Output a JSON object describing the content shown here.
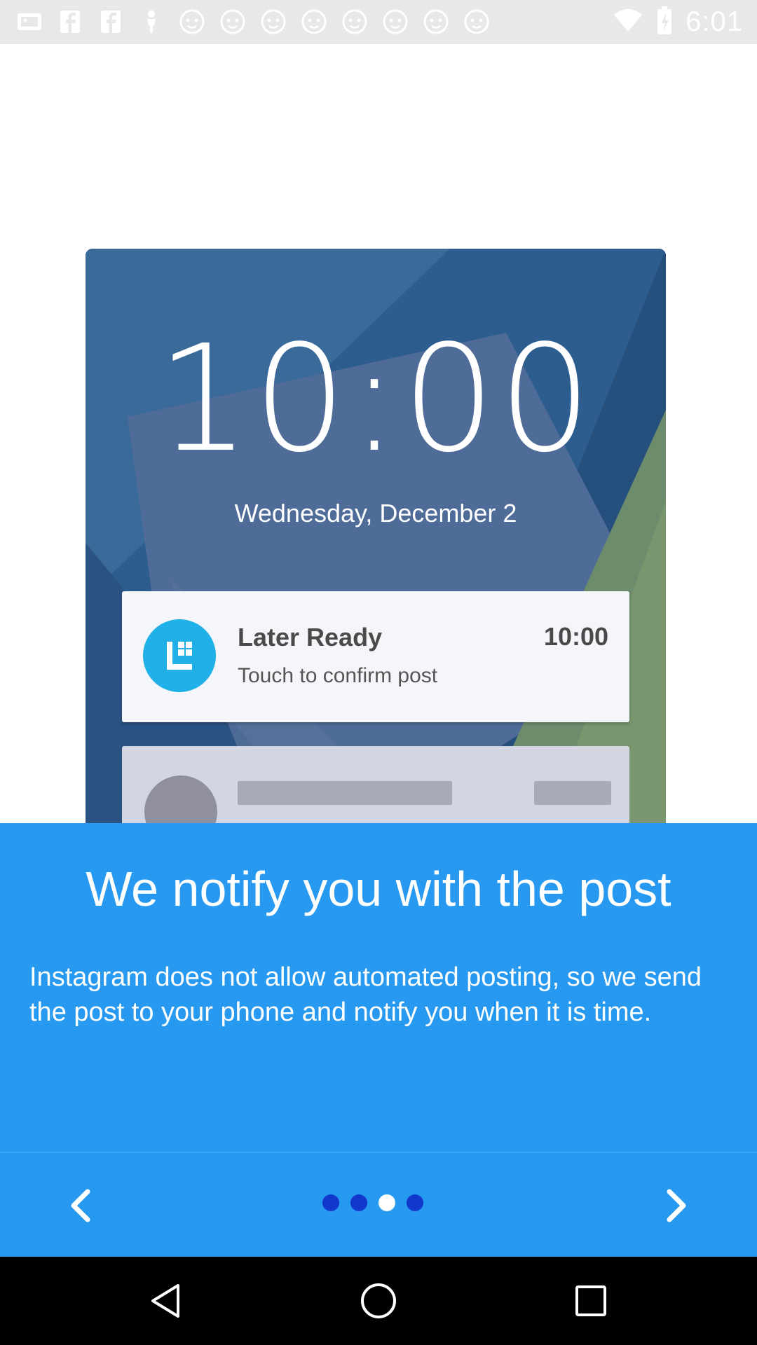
{
  "status_bar": {
    "time": "6:01",
    "icons": [
      "photo-icon",
      "facebook-icon",
      "facebook-icon",
      "person-icon",
      "cat-icon",
      "cat-icon",
      "cat-icon",
      "cat-icon",
      "cat-icon",
      "cat-icon",
      "cat-icon",
      "cat-icon",
      "wifi-icon",
      "battery-icon"
    ]
  },
  "illustration": {
    "lock_time": "10:00",
    "lock_date": "Wednesday, December 2",
    "notification": {
      "title": "Later Ready",
      "subtitle": "Touch to confirm post",
      "time": "10:00",
      "app_color": "#1fb0e8"
    }
  },
  "onboarding": {
    "headline": "We notify you with the post",
    "body": "Instagram does not allow automated posting, so we send the post to your phone and notify you when it is time.",
    "accent_color": "#2799f0"
  },
  "pager": {
    "total_pages": 4,
    "current_page": 3,
    "prev_icon": "chevron-left-icon",
    "next_icon": "chevron-right-icon"
  },
  "system_nav": {
    "back_icon": "back-triangle-icon",
    "home_icon": "home-circle-icon",
    "recents_icon": "recents-square-icon"
  }
}
